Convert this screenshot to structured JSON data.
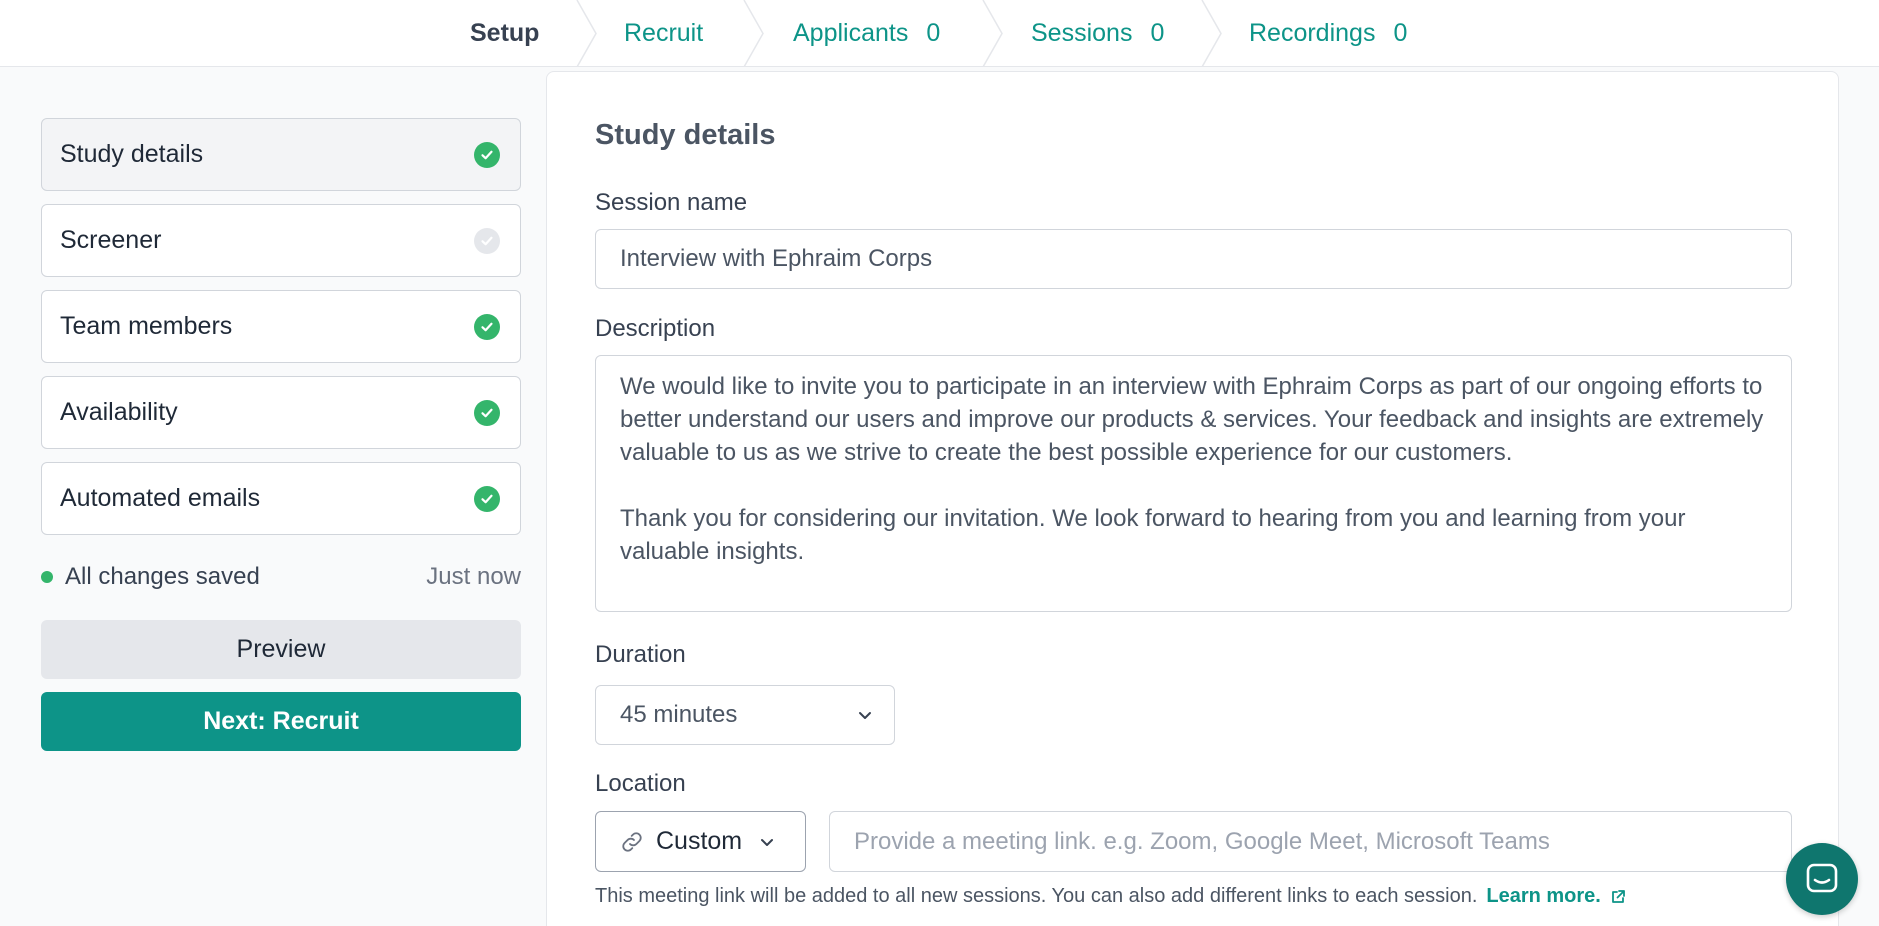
{
  "nav": {
    "steps": [
      {
        "label": "Setup",
        "count": null
      },
      {
        "label": "Recruit",
        "count": null
      },
      {
        "label": "Applicants",
        "count": "0"
      },
      {
        "label": "Sessions",
        "count": "0"
      },
      {
        "label": "Recordings",
        "count": "0"
      }
    ],
    "active_step": "Setup"
  },
  "sidebar": {
    "items": [
      {
        "label": "Study details",
        "status": "complete"
      },
      {
        "label": "Screener",
        "status": "incomplete"
      },
      {
        "label": "Team members",
        "status": "complete"
      },
      {
        "label": "Availability",
        "status": "complete"
      },
      {
        "label": "Automated emails",
        "status": "complete"
      }
    ],
    "save_status": "All changes saved",
    "save_time": "Just now",
    "preview_label": "Preview",
    "next_label": "Next: Recruit"
  },
  "form": {
    "title": "Study details",
    "session_name_label": "Session name",
    "session_name_value": "Interview with Ephraim Corps",
    "description_label": "Description",
    "description_p1": "We would like to invite you to participate in an interview with Ephraim Corps as part of our ongoing efforts to better understand our users and improve our products & services. Your feedback and insights are extremely valuable to us as we strive to create the best possible experience for our customers.",
    "description_p2": "Thank you for considering our invitation. We look forward to hearing from you and learning from your valuable insights.",
    "duration_label": "Duration",
    "duration_value": "45 minutes",
    "location_label": "Location",
    "location_type": "Custom",
    "location_link_placeholder": "Provide a meeting link. e.g. Zoom, Google Meet, Microsoft Teams",
    "location_help": "This meeting link will be added to all new sessions. You can also add different links to each session.",
    "learn_more_label": "Learn more."
  },
  "colors": {
    "accent": "#0d9488",
    "success": "#34b56b",
    "chat_bubble": "#0f766e"
  },
  "icons": {
    "status_complete": "check-circle-icon",
    "status_incomplete": "check-circle-gray-icon",
    "dropdown": "chevron-down-icon",
    "link": "link-icon",
    "external": "external-link-icon",
    "chat": "chat-icon"
  }
}
